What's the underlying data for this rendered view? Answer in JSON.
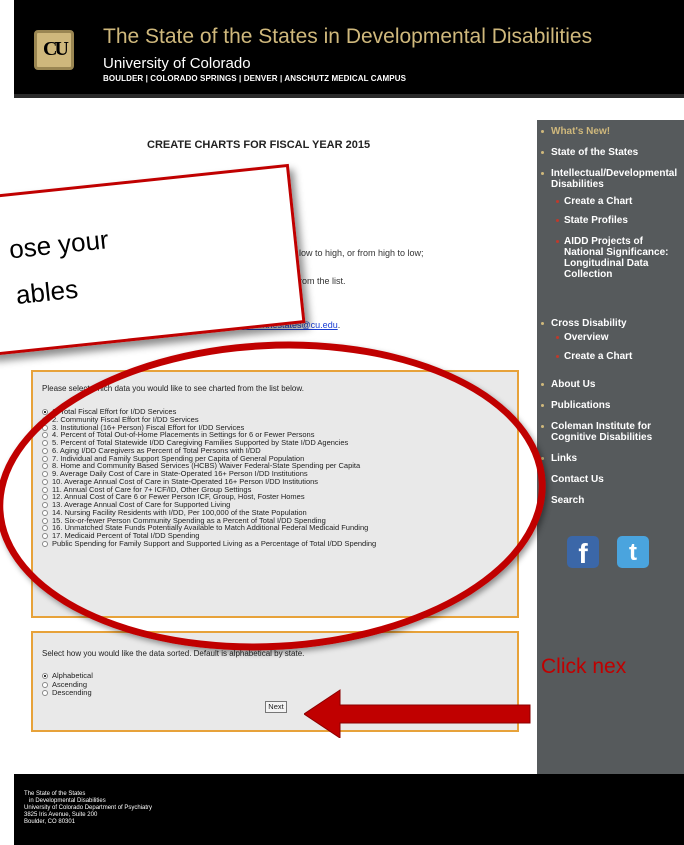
{
  "header": {
    "logo_text": "CU",
    "site_title": "The State of the States in Developmental Disabilities",
    "university": "University of Colorado",
    "campuses": "BOULDER | COLORADO SPRINGS | DENVER  | ANSCHUTZ MEDICAL CAMPUS"
  },
  "main": {
    "title": "CREATE CHARTS FOR FISCAL YEAR 2015",
    "instr_sort_tail": "low to high, or from high to low;",
    "instr_list_tail": "rom the list.",
    "email": "stateofthestates@cu.edu",
    "email_trailing": ".",
    "panel1_prompt": "Please select which data you would like to see charted from the list below.",
    "options": [
      "1. Total Fiscal Effort for I/DD Services",
      "2. Community Fiscal Effort for I/DD Services",
      "3. Institutional (16+ Person) Fiscal Effort for I/DD Services",
      "4. Percent of Total Out-of-Home Placements in Settings for 6 or Fewer Persons",
      "5. Percent of Total Statewide I/DD Caregiving Families Supported by State I/DD Agencies",
      "6. Aging I/DD Caregivers as Percent of Total Persons with I/DD",
      "7. Individual and Family Support Spending per Capita of General Population",
      "8. Home and Community Based Services (HCBS) Waiver Federal-State Spending per Capita",
      "9. Average Daily Cost of Care in State-Operated 16+ Person I/DD Institutions",
      "10. Average Annual Cost of Care in State-Operated 16+ Person I/DD Institutions",
      "11. Annual Cost of Care for 7+ ICF/ID, Other Group Settings",
      "12. Annual Cost of Care 6 or Fewer Person ICF, Group, Host, Foster Homes",
      "13. Average Annual Cost of Care for Supported Living",
      "14. Nursing Facility Residents with I/DD, Per 100,000 of the State Population",
      "15. Six-or-fewer Person Community Spending as a Percent of Total I/DD Spending",
      "16. Unmatched State Funds Potentially Available to Match Additional Federal Medicaid Funding",
      "17. Medicaid Percent of Total I/DD Spending",
      "Public Spending for Family Support and Supported Living as a Percentage of Total I/DD Spending"
    ],
    "panel2_prompt": "Select how you would like the data sorted. Default is alphabetical by state.",
    "sort_options": [
      "Alphabetical",
      "Ascending",
      "Descending"
    ],
    "next_label": "Next"
  },
  "nav": {
    "items": [
      {
        "label": "What's New!",
        "accent": true,
        "sub": false
      },
      {
        "label": "State of the States",
        "accent": false,
        "sub": false
      },
      {
        "label": "Intellectual/Developmental Disabilities",
        "accent": false,
        "sub": false
      },
      {
        "label": "Create a Chart",
        "accent": false,
        "sub": true
      },
      {
        "label": "State Profiles",
        "accent": false,
        "sub": true
      },
      {
        "label": "AIDD Projects of National Significance: Longitudinal Data Collection",
        "accent": false,
        "sub": true
      },
      {
        "label": "Cross Disability",
        "accent": false,
        "sub": false
      },
      {
        "label": "Overview",
        "accent": false,
        "sub": true
      },
      {
        "label": "Create a Chart",
        "accent": false,
        "sub": true
      },
      {
        "label": "About Us",
        "accent": false,
        "sub": false
      },
      {
        "label": "Publications",
        "accent": false,
        "sub": false
      },
      {
        "label": "Coleman Institute for Cognitive Disabilities",
        "accent": false,
        "sub": false
      },
      {
        "label": "Links",
        "accent": false,
        "sub": false
      },
      {
        "label": "Contact Us",
        "accent": false,
        "sub": false
      },
      {
        "label": "Search",
        "accent": false,
        "sub": false
      }
    ],
    "facebook_glyph": "f",
    "twitter_glyph": "t"
  },
  "footer": {
    "lines": [
      "The State of the States",
      "in Developmental Disabilities",
      "University of Colorado Department of Psychiatry",
      "3825 Iris Avenue, Suite 200",
      "Boulder, CO 80301"
    ]
  },
  "annotations": {
    "callout_line1": "ose your",
    "callout_line2": "ables",
    "click_next": "Click nex",
    "accent_color": "#c00000"
  }
}
